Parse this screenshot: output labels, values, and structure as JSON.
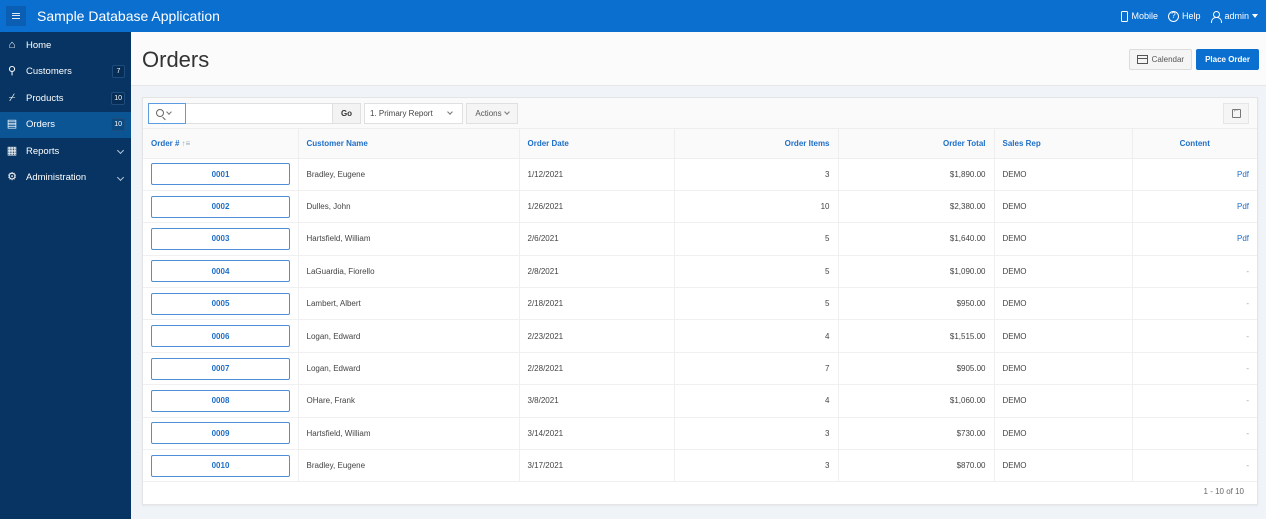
{
  "app": {
    "title": "Sample Database Application",
    "nav_right": {
      "mobile": "Mobile",
      "help": "Help",
      "user": "admin"
    }
  },
  "sidebar": {
    "items": [
      {
        "label": "Home",
        "icon": "home-icon",
        "badge": null,
        "chevron": false,
        "active": false
      },
      {
        "label": "Customers",
        "icon": "users-icon",
        "badge": "7",
        "chevron": false,
        "active": false
      },
      {
        "label": "Products",
        "icon": "cart-icon",
        "badge": "10",
        "chevron": false,
        "active": false
      },
      {
        "label": "Orders",
        "icon": "list-icon",
        "badge": "10",
        "chevron": false,
        "active": true
      },
      {
        "label": "Reports",
        "icon": "table-icon",
        "badge": null,
        "chevron": true,
        "active": false
      },
      {
        "label": "Administration",
        "icon": "gear-icon",
        "badge": null,
        "chevron": true,
        "active": false
      }
    ]
  },
  "page": {
    "title": "Orders",
    "buttons": {
      "calendar": "Calendar",
      "place_order": "Place Order"
    }
  },
  "report": {
    "toolbar": {
      "search_value": "",
      "go": "Go",
      "report_select": "1. Primary Report",
      "actions": "Actions"
    },
    "columns": [
      "Order #",
      "Customer Name",
      "Order Date",
      "Order Items",
      "Order Total",
      "Sales Rep",
      "Content"
    ],
    "sort_indicator": "↑≡",
    "rows": [
      {
        "order": "0001",
        "customer": "Bradley, Eugene",
        "date": "1/12/2021",
        "items": "3",
        "total": "$1,890.00",
        "rep": "DEMO",
        "content": "Pdf"
      },
      {
        "order": "0002",
        "customer": "Dulles, John",
        "date": "1/26/2021",
        "items": "10",
        "total": "$2,380.00",
        "rep": "DEMO",
        "content": "Pdf"
      },
      {
        "order": "0003",
        "customer": "Hartsfield, William",
        "date": "2/6/2021",
        "items": "5",
        "total": "$1,640.00",
        "rep": "DEMO",
        "content": "Pdf"
      },
      {
        "order": "0004",
        "customer": "LaGuardia, Fiorello",
        "date": "2/8/2021",
        "items": "5",
        "total": "$1,090.00",
        "rep": "DEMO",
        "content": "-"
      },
      {
        "order": "0005",
        "customer": "Lambert, Albert",
        "date": "2/18/2021",
        "items": "5",
        "total": "$950.00",
        "rep": "DEMO",
        "content": "-"
      },
      {
        "order": "0006",
        "customer": "Logan, Edward",
        "date": "2/23/2021",
        "items": "4",
        "total": "$1,515.00",
        "rep": "DEMO",
        "content": "-"
      },
      {
        "order": "0007",
        "customer": "Logan, Edward",
        "date": "2/28/2021",
        "items": "7",
        "total": "$905.00",
        "rep": "DEMO",
        "content": "-"
      },
      {
        "order": "0008",
        "customer": "OHare, Frank",
        "date": "3/8/2021",
        "items": "4",
        "total": "$1,060.00",
        "rep": "DEMO",
        "content": "-"
      },
      {
        "order": "0009",
        "customer": "Hartsfield, William",
        "date": "3/14/2021",
        "items": "3",
        "total": "$730.00",
        "rep": "DEMO",
        "content": "-"
      },
      {
        "order": "0010",
        "customer": "Bradley, Eugene",
        "date": "3/17/2021",
        "items": "3",
        "total": "$870.00",
        "rep": "DEMO",
        "content": "-"
      }
    ],
    "pagination": "1 - 10 of 10"
  },
  "colors": {
    "brand": "#0b6fd0",
    "sidebar": "#073462",
    "sidebar_active": "#0b5595",
    "link": "#1f6fc7"
  }
}
